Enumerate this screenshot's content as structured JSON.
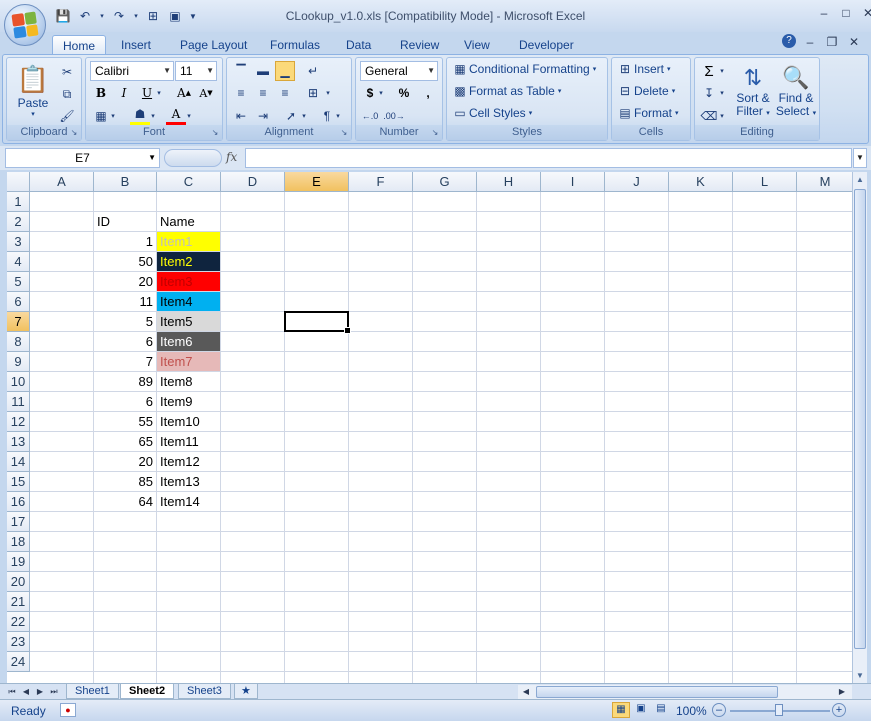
{
  "window": {
    "title": "CLookup_v1.0.xls  [Compatibility Mode] - Microsoft Excel"
  },
  "ribbon_tabs": [
    "Home",
    "Insert",
    "Page Layout",
    "Formulas",
    "Data",
    "Review",
    "View",
    "Developer"
  ],
  "active_tab": "Home",
  "ribbon": {
    "clipboard": {
      "label": "Clipboard",
      "paste": "Paste"
    },
    "font": {
      "label": "Font",
      "font_name": "Calibri",
      "font_size": "11",
      "bold": "B",
      "italic": "I",
      "underline": "U"
    },
    "alignment": {
      "label": "Alignment"
    },
    "number": {
      "label": "Number",
      "format": "General",
      "currency": "$",
      "percent": "%",
      "comma": ","
    },
    "styles": {
      "label": "Styles",
      "conditional": "Conditional Formatting",
      "format_table": "Format as Table",
      "cell_styles": "Cell Styles"
    },
    "cells": {
      "label": "Cells",
      "insert": "Insert",
      "delete": "Delete",
      "format": "Format"
    },
    "editing": {
      "label": "Editing",
      "sort_line1": "Sort &",
      "sort_line2": "Filter",
      "find_line1": "Find &",
      "find_line2": "Select"
    }
  },
  "formula_bar": {
    "name_box": "E7",
    "fx": "fx",
    "formula": ""
  },
  "columns": [
    "A",
    "B",
    "C",
    "D",
    "E",
    "F",
    "G",
    "H",
    "I",
    "J",
    "K",
    "L",
    "M"
  ],
  "selected_column": "E",
  "selected_row": 7,
  "rows": [
    1,
    2,
    3,
    4,
    5,
    6,
    7,
    8,
    9,
    10,
    11,
    12,
    13,
    14,
    15,
    16,
    17,
    18,
    19,
    20,
    21,
    22,
    23,
    24
  ],
  "table": {
    "header_id": "ID",
    "header_name": "Name",
    "records": [
      {
        "id": "1",
        "name": "Item1",
        "bg": "#ffff00",
        "fg": "#bfbfbf"
      },
      {
        "id": "50",
        "name": "Item2",
        "bg": "#0f243e",
        "fg": "#ffff00"
      },
      {
        "id": "20",
        "name": "Item3",
        "bg": "#ff0000",
        "fg": "#c00000"
      },
      {
        "id": "11",
        "name": "Item4",
        "bg": "#00b0f0",
        "fg": "#000000"
      },
      {
        "id": "5",
        "name": "Item5",
        "bg": "#d9d9d9",
        "fg": "#000000"
      },
      {
        "id": "6",
        "name": "Item6",
        "bg": "#595959",
        "fg": "#ffffff"
      },
      {
        "id": "7",
        "name": "Item7",
        "bg": "#e6b9b8",
        "fg": "#c0504d"
      },
      {
        "id": "89",
        "name": "Item8",
        "bg": "",
        "fg": "#000000"
      },
      {
        "id": "6",
        "name": "Item9",
        "bg": "",
        "fg": "#000000"
      },
      {
        "id": "55",
        "name": "Item10",
        "bg": "",
        "fg": "#000000"
      },
      {
        "id": "65",
        "name": "Item11",
        "bg": "",
        "fg": "#000000"
      },
      {
        "id": "20",
        "name": "Item12",
        "bg": "",
        "fg": "#000000"
      },
      {
        "id": "85",
        "name": "Item13",
        "bg": "",
        "fg": "#000000"
      },
      {
        "id": "64",
        "name": "Item14",
        "bg": "",
        "fg": "#000000"
      }
    ]
  },
  "sheets": [
    "Sheet1",
    "Sheet2",
    "Sheet3"
  ],
  "active_sheet": "Sheet2",
  "status": {
    "ready": "Ready",
    "zoom": "100%"
  }
}
